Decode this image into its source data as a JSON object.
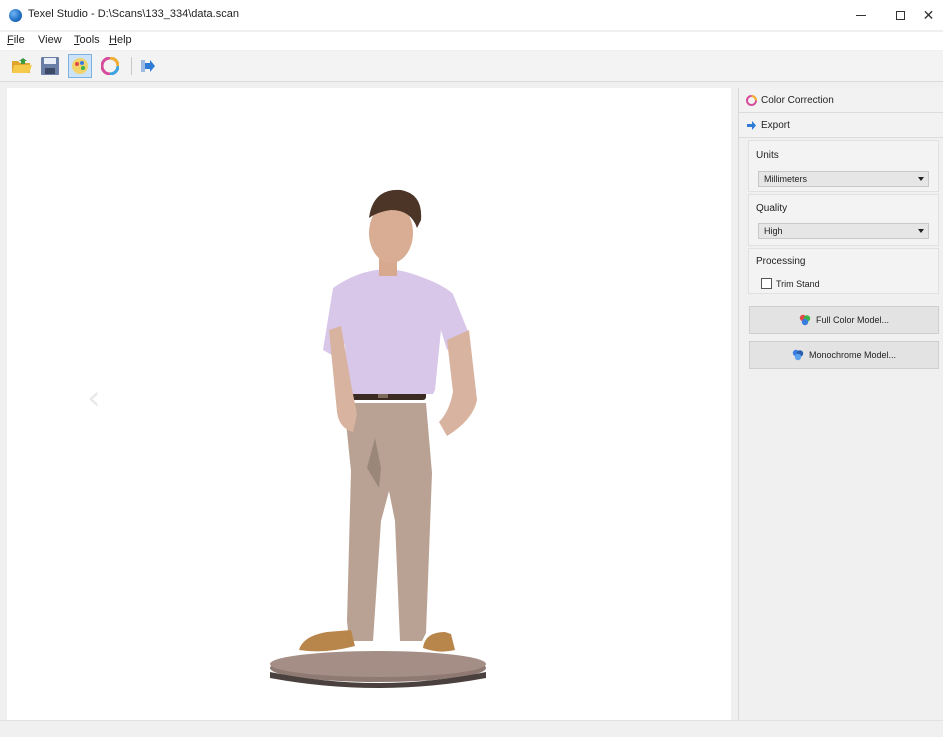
{
  "window": {
    "title": "Texel Studio - D:\\Scans\\133_334\\data.scan",
    "minimize_label": "—",
    "close_label": "✕"
  },
  "menu": [
    {
      "label": "File",
      "underline": "F",
      "rest": "ile"
    },
    {
      "label": "View",
      "underline": "",
      "rest": "View"
    },
    {
      "label": "Tools",
      "underline": "T",
      "rest": "ools"
    },
    {
      "label": "Help",
      "underline": "H",
      "rest": "elp"
    }
  ],
  "toolbar": [
    {
      "icon": "open-folder-icon"
    },
    {
      "icon": "save-icon"
    },
    {
      "icon": "paint-icon",
      "active": true
    },
    {
      "icon": "color-wheel-icon"
    },
    {
      "icon": "export-arrow-icon"
    }
  ],
  "panel": {
    "color_correction_tab": "Color Correction",
    "export_tab": "Export",
    "units": {
      "title": "Units",
      "value": "Millimeters"
    },
    "quality": {
      "title": "Quality",
      "value": "High"
    },
    "processing": {
      "title": "Processing",
      "trim_stand_label": "Trim Stand",
      "trim_stand_checked": false
    },
    "full_color_button": "Full Color Model...",
    "monochrome_button": "Monochrome Model..."
  },
  "colors": {
    "accent_blue": "#1f6fc4",
    "shirt": "#d9c7ea",
    "pants": "#b8a293",
    "stand": "#a58e86"
  }
}
